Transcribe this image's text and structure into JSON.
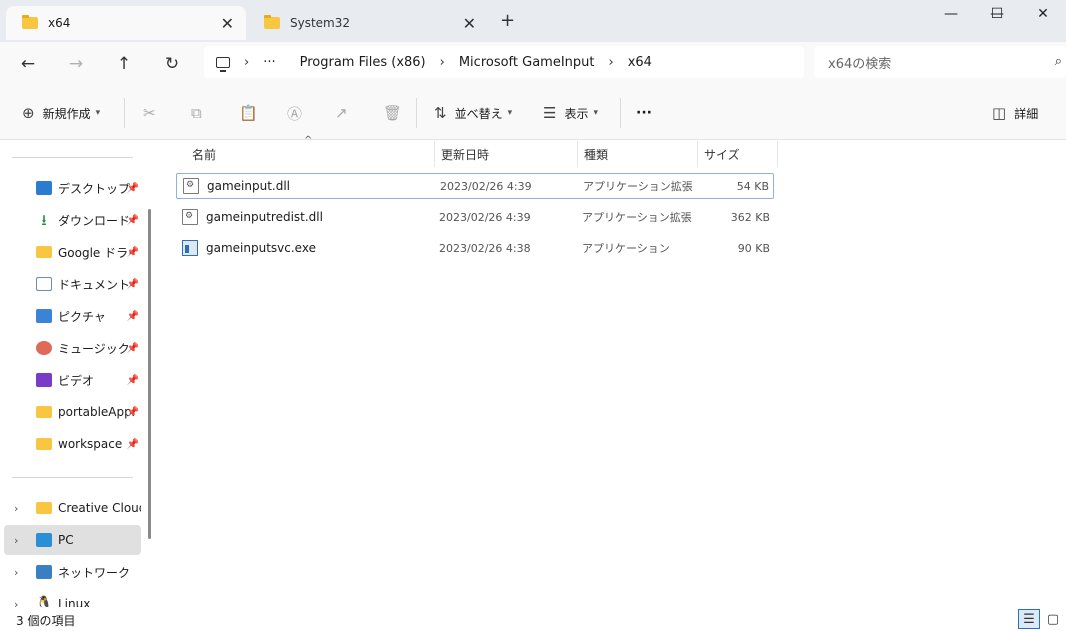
{
  "tabs": [
    {
      "label": "x64",
      "active": true
    },
    {
      "label": "System32",
      "active": false
    }
  ],
  "window_controls": {
    "minimize": "—",
    "maximize": "☐",
    "close": "✕"
  },
  "nav": {
    "back": "←",
    "forward": "→",
    "up": "↑",
    "refresh": "↻"
  },
  "address": {
    "more": "···",
    "crumbs": [
      "Program Files (x86)",
      "Microsoft GameInput",
      "x64"
    ],
    "separator": "›"
  },
  "search": {
    "placeholder": "x64の検索"
  },
  "toolbar": {
    "new_label": "新規作成",
    "sort_label": "並べ替え",
    "view_label": "表示",
    "more_label": "···",
    "details_label": "詳細"
  },
  "sidebar": {
    "quick_access": [
      {
        "label": "デスクトップ",
        "icon": "desktop-icon"
      },
      {
        "label": "ダウンロード",
        "icon": "download-icon"
      },
      {
        "label": "Google ドライブ",
        "icon": "folder-icon"
      },
      {
        "label": "ドキュメント",
        "icon": "document-icon"
      },
      {
        "label": "ピクチャ",
        "icon": "pictures-icon"
      },
      {
        "label": "ミュージック",
        "icon": "music-icon"
      },
      {
        "label": "ビデオ",
        "icon": "video-icon"
      },
      {
        "label": "portableApps",
        "icon": "folder-icon"
      },
      {
        "label": "workspace",
        "icon": "folder-icon"
      }
    ],
    "tree": [
      {
        "label": "Creative Cloud Files",
        "icon": "creative-cloud-icon"
      },
      {
        "label": "PC",
        "icon": "pc-icon",
        "selected": true
      },
      {
        "label": "ネットワーク",
        "icon": "network-icon"
      },
      {
        "label": "Linux",
        "icon": "linux-icon"
      }
    ]
  },
  "columns": {
    "name": "名前",
    "date": "更新日時",
    "type": "種類",
    "size": "サイズ"
  },
  "files": [
    {
      "name": "gameinput.dll",
      "date": "2023/02/26 4:39",
      "type": "アプリケーション拡張",
      "size": "54 KB",
      "kind": "dll"
    },
    {
      "name": "gameinputredist.dll",
      "date": "2023/02/26 4:39",
      "type": "アプリケーション拡張",
      "size": "362 KB",
      "kind": "dll"
    },
    {
      "name": "gameinputsvc.exe",
      "date": "2023/02/26 4:38",
      "type": "アプリケーション",
      "size": "90 KB",
      "kind": "exe"
    }
  ],
  "status": {
    "count": "3 個の項目"
  }
}
